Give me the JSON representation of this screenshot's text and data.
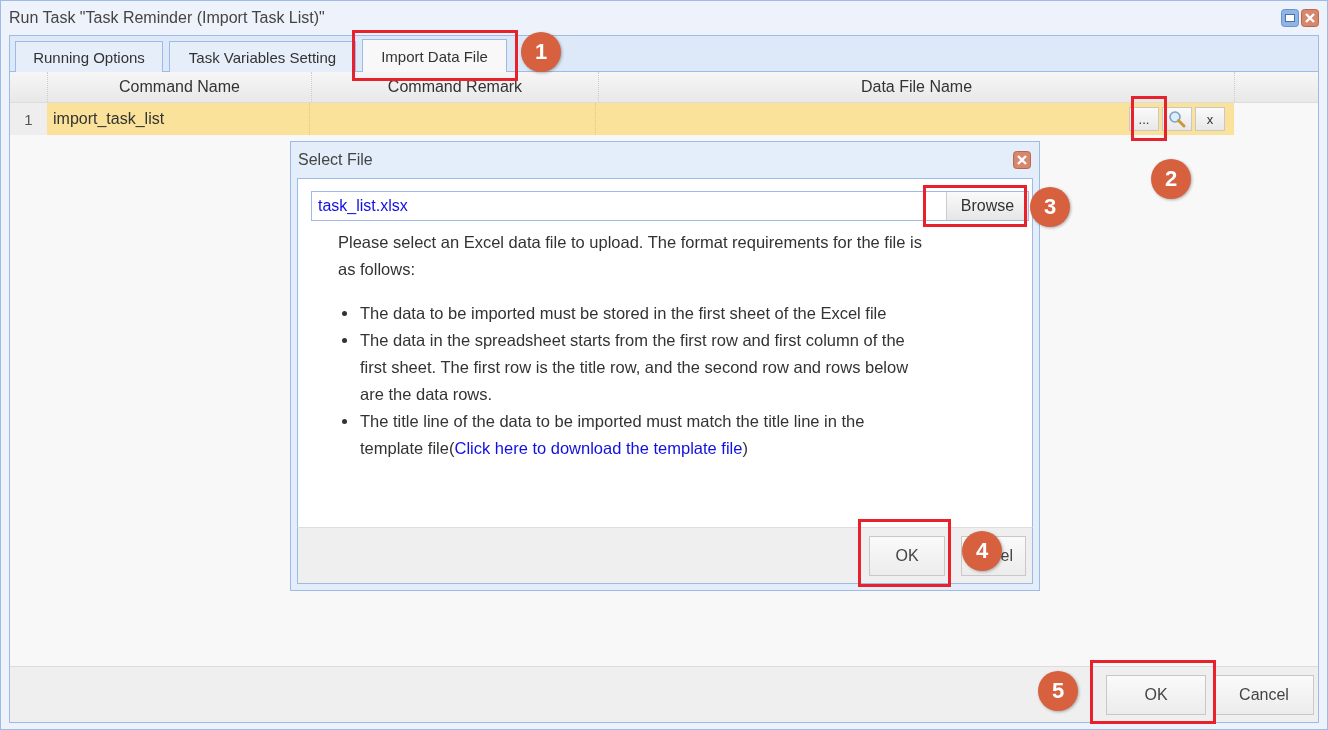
{
  "window": {
    "title": "Run Task \"Task Reminder (Import Task List)\""
  },
  "tabs": [
    {
      "label": "Running Options",
      "selected": false
    },
    {
      "label": "Task Variables Setting",
      "selected": false
    },
    {
      "label": "Import Data File",
      "selected": true
    }
  ],
  "table": {
    "columns": [
      "Command Name",
      "Command Remark",
      "Data File Name"
    ],
    "rows": [
      {
        "number": "1",
        "command_name": "import_task_list",
        "command_remark": "",
        "selected": true,
        "buttons": [
          "...",
          "x"
        ]
      }
    ]
  },
  "dialog": {
    "title": "Select File",
    "file_value": "task_list.xlsx",
    "browse": "Browse",
    "intro": "Please select an Excel data file to upload. The format requirements for the file is as follows:",
    "bullets": [
      {
        "text": "The data to be imported must be stored in the first sheet of the Excel file"
      },
      {
        "text": "The data in the spreadsheet starts from the first row and first column of the first sheet. The first row is the title row, and the second row and rows below are the data rows."
      },
      {
        "text": "The title line of the data to be imported must match the title line in the template file(",
        "link": "Click here to download the template file",
        "after": ")"
      }
    ],
    "buttons": [
      "OK",
      "el"
    ]
  },
  "buttons": [
    "OK",
    "Cancel"
  ],
  "annotations": [
    {
      "number": "1"
    },
    {
      "number": "2"
    },
    {
      "number": "3"
    },
    {
      "number": "4"
    },
    {
      "number": "5"
    }
  ]
}
